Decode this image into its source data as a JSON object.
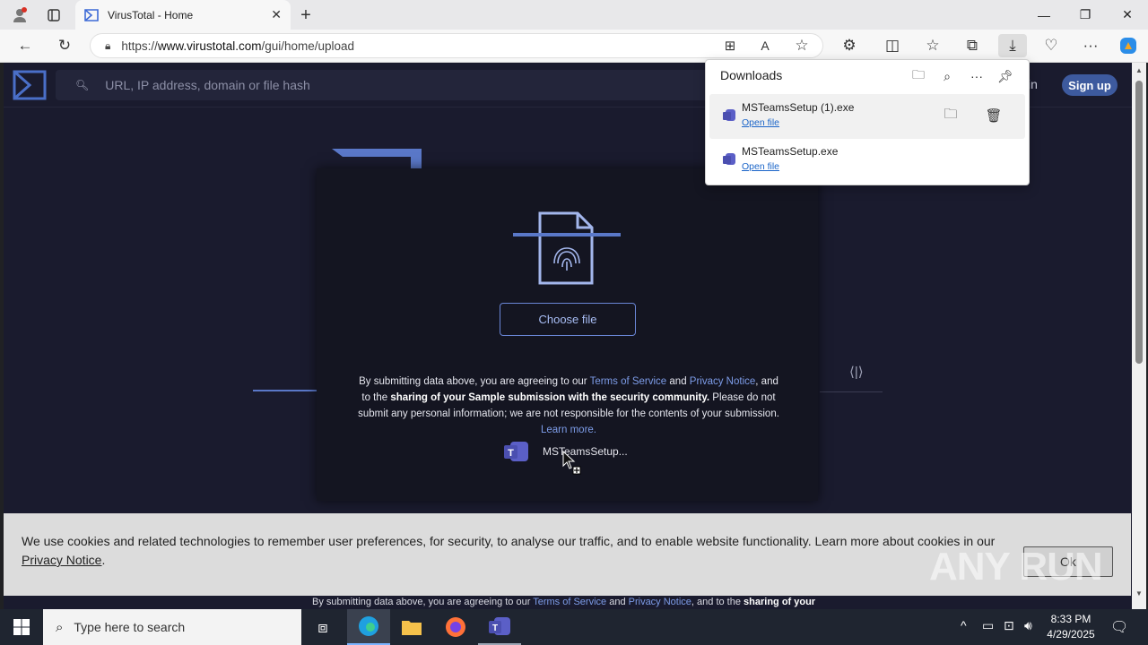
{
  "browser": {
    "tab_title": "VirusTotal - Home",
    "url_prefix": "https://",
    "url_host": "www.virustotal.com",
    "url_path": "/gui/home/upload"
  },
  "page": {
    "search_placeholder": "URL, IP address, domain or file hash",
    "signin_label": "in",
    "signup_label": "Sign up",
    "choose_file_label": "Choose file",
    "disclaimer": {
      "part1": "By submitting data above, you are agreeing to our ",
      "terms": "Terms of Service",
      "and": " and ",
      "privacy": "Privacy Notice",
      "part2": ", and to the ",
      "bold": "sharing of your Sample submission with the security community.",
      "part3": " Please do not submit any personal information; we are not responsible for the contents of your submission. ",
      "learn_more": "Learn more."
    },
    "drag_file_label": "MSTeamsSetup...",
    "bottom_strip": {
      "part1": "By submitting data above, you are agreeing to our ",
      "terms": "Terms of Service",
      "and": " and ",
      "privacy": "Privacy Notice",
      "part2": ", and to the ",
      "bold": "sharing of your"
    }
  },
  "cookie": {
    "text": "We use cookies and related technologies to remember user preferences, for security, to analyse our traffic, and to enable website functionality. Learn more about cookies in our ",
    "link": "Privacy Notice",
    "end": ".",
    "ok_label": "Ok"
  },
  "watermark": "ANY RUN",
  "downloads": {
    "title": "Downloads",
    "items": [
      {
        "name": "MSTeamsSetup (1).exe",
        "action": "Open file"
      },
      {
        "name": "MSTeamsSetup.exe",
        "action": "Open file"
      }
    ]
  },
  "taskbar": {
    "search_placeholder": "Type here to search",
    "time": "8:33 PM",
    "date": "4/29/2025"
  },
  "colors": {
    "accent": "#5a78c8",
    "page_bg": "#1a1b2e",
    "link": "#7d9ce8"
  }
}
